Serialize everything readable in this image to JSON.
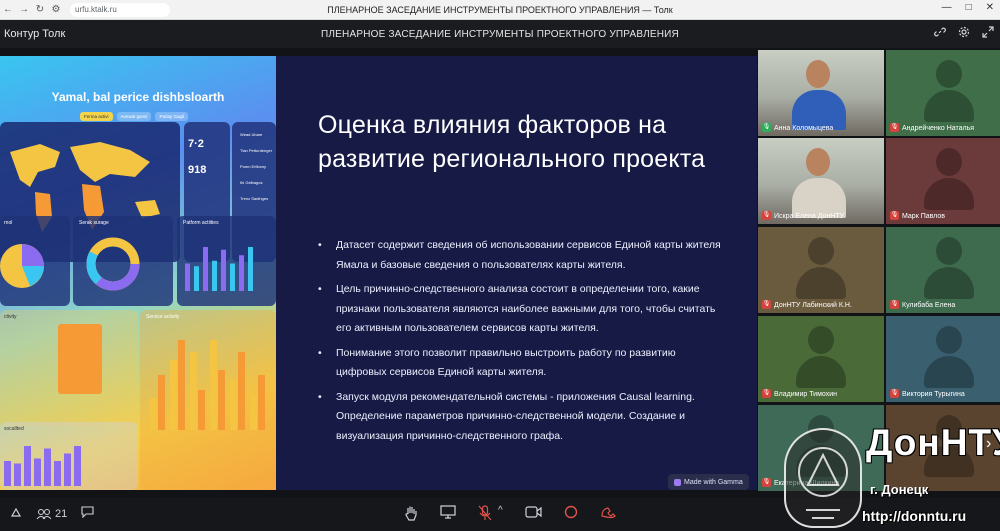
{
  "browser": {
    "nav_back": "←",
    "nav_forward": "→",
    "reload": "↻",
    "site_icon": "⚙",
    "url": "urfu.ktalk.ru",
    "tab_title": "ПЛЕНАРНОЕ ЗАСЕДАНИЕ ИНСТРУМЕНТЫ ПРОЕКТНОГО УПРАВЛЕНИЯ — Толк",
    "minimize": "—",
    "maximize": "□",
    "close": "✕"
  },
  "app": {
    "name": "Контур Толк",
    "meeting_title": "ПЛЕНАРНОЕ ЗАСЕДАНИЕ ИНСТРУМЕНТЫ ПРОЕКТНОГО УПРАВЛЕНИЯ",
    "link_icon": "🔗",
    "settings_icon": "⚙",
    "fullscreen_icon": "⤢"
  },
  "slide": {
    "dashboard": {
      "title": "Yamal, bal perice dishbslоarth",
      "tabs": [
        "Ferma activi",
        "Avewat gamit",
        "Parlay Gagil"
      ],
      "kpi1": "7·2",
      "kpi2": "918",
      "panel_labels": [
        "Serak surage",
        "Patform actiities",
        "Service activity",
        "rnol",
        "ctivity",
        "socallted"
      ],
      "legend": [
        "Wead Ubare",
        "Tlan Petturdenger",
        "Pumn Erltiomy",
        "Ihi Gelbagos",
        "Trenz Santhges"
      ],
      "service_values": [
        [
          0.32,
          0.55
        ],
        [
          0.7,
          0.9
        ],
        [
          0.78,
          0.4
        ],
        [
          0.9,
          0.6
        ],
        [
          0.5,
          0.78
        ],
        [
          0.35,
          0.55
        ]
      ],
      "left_values": [
        0.5,
        0.45,
        0.8,
        0.55,
        0.75,
        0.5,
        0.65,
        0.8
      ],
      "colors": {
        "cyan": "#39c6f0",
        "yellow": "#f4c542",
        "orange": "#f59a35",
        "purple": "#8b6cf0",
        "navy": "#1e3278"
      }
    },
    "title": "Оценка влияния факторов на развитие регионального проекта",
    "bullets": [
      "Датасет содержит сведения об использовании сервисов Единой карты жителя Ямала и базовые сведения о пользователях карты жителя.",
      "Цель причинно-следственного анализа состоит в определении того, какие признаки пользователя являются наиболее важными для того, чтобы считать его активным пользователем сервисов карты жителя.",
      "Понимание этого позволит правильно выстроить работу по развитию цифровых сервисов Единой карты жителя.",
      "Запуск модуля рекомендательной системы - приложения Causal learning. Определение параметров причинно-следственной модели. Создание и визуализация причинно-следственного графа."
    ],
    "badge": "Made with Gamma"
  },
  "participants": [
    {
      "name": "Анна Коломыцева",
      "video": true,
      "mic_on": true,
      "tile_color": "#6b7b6a"
    },
    {
      "name": "Андрейченко Наталья",
      "video": false,
      "mic_on": false,
      "tile_color": "#3f6e48"
    },
    {
      "name": "Искра Елена ДонНТУ",
      "video": true,
      "mic_on": false,
      "tile_color": "#7a7065"
    },
    {
      "name": "Марк Павлов",
      "video": false,
      "mic_on": false,
      "tile_color": "#6b3a3a"
    },
    {
      "name": "ДонНТУ Лабинский К.Н.",
      "video": false,
      "mic_on": false,
      "tile_color": "#6a5a3e"
    },
    {
      "name": "Кулибаба Елена",
      "video": false,
      "mic_on": false,
      "tile_color": "#3e6a4d"
    },
    {
      "name": "Владимир Тимохин",
      "video": false,
      "mic_on": false,
      "tile_color": "#4a6a38"
    },
    {
      "name": "Виктория Турыгина",
      "video": false,
      "mic_on": false,
      "tile_color": "#3a6070"
    },
    {
      "name": "Екатерина Шилкина",
      "video": false,
      "mic_on": false,
      "tile_color": "#3f6a58"
    },
    {
      "name": "",
      "video": false,
      "mic_on": false,
      "tile_color": "#5a4430"
    }
  ],
  "toolbar": {
    "participants_icon": "👥",
    "participants_count": "21",
    "chat_icon": "💬",
    "hand_icon": "✋",
    "screen_icon": "🖥",
    "mic_icon": "🎙",
    "mic_menu": "^",
    "camera_icon": "📷",
    "record_icon": "◯",
    "leave_icon": "☎",
    "next_icon": "›"
  },
  "watermark": {
    "title": "ДонНТУ",
    "city": "г. Донецк",
    "url": "http://donntu.ru"
  }
}
